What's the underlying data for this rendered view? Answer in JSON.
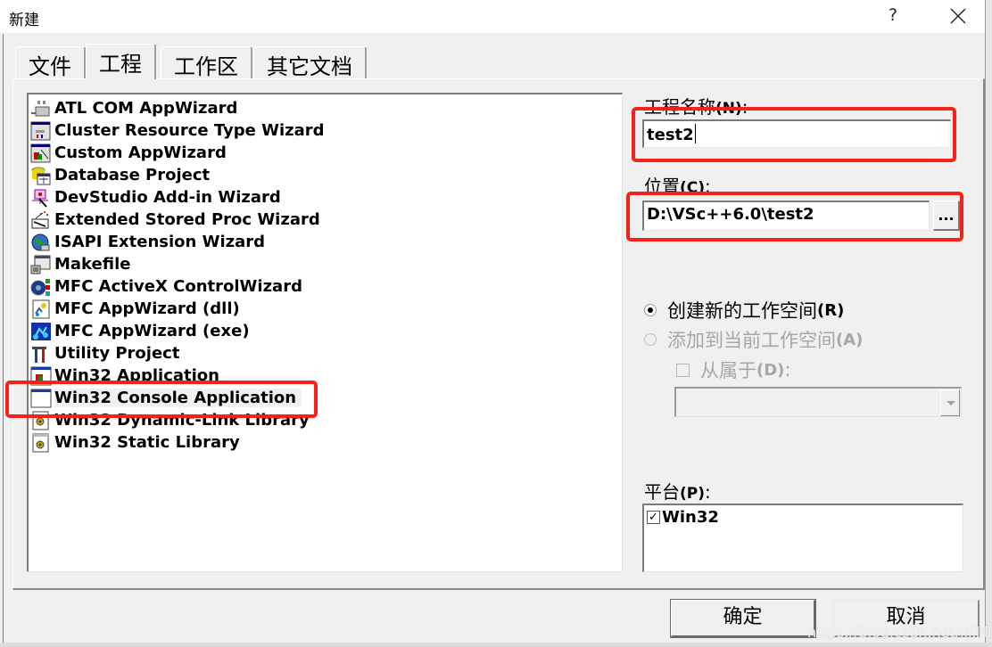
{
  "window": {
    "title": "新建",
    "help_label": "?",
    "close_icon": "close-icon"
  },
  "tabs": [
    {
      "label": "文件",
      "active": false
    },
    {
      "label": "工程",
      "active": true
    },
    {
      "label": "工作区",
      "active": false
    },
    {
      "label": "其它文档",
      "active": false
    }
  ],
  "project_types": [
    {
      "label": "ATL COM AppWizard",
      "icon": "atl-com-icon"
    },
    {
      "label": "Cluster Resource Type Wizard",
      "icon": "cluster-resource-icon"
    },
    {
      "label": "Custom AppWizard",
      "icon": "custom-appwizard-icon"
    },
    {
      "label": "Database Project",
      "icon": "database-icon"
    },
    {
      "label": "DevStudio Add-in Wizard",
      "icon": "devstudio-addin-icon"
    },
    {
      "label": "Extended Stored Proc Wizard",
      "icon": "stored-proc-icon"
    },
    {
      "label": "ISAPI Extension Wizard",
      "icon": "globe-icon"
    },
    {
      "label": "Makefile",
      "icon": "makefile-icon"
    },
    {
      "label": "MFC ActiveX ControlWizard",
      "icon": "activex-icon"
    },
    {
      "label": "MFC AppWizard (dll)",
      "icon": "mfc-dll-icon"
    },
    {
      "label": "MFC AppWizard (exe)",
      "icon": "mfc-exe-icon"
    },
    {
      "label": "Utility Project",
      "icon": "utility-icon"
    },
    {
      "label": "Win32 Application",
      "icon": "win32-app-icon"
    },
    {
      "label": "Win32 Console Application",
      "icon": "console-window-icon",
      "selected": true
    },
    {
      "label": "Win32 Dynamic-Link Library",
      "icon": "dll-icon"
    },
    {
      "label": "Win32 Static Library",
      "icon": "static-lib-icon"
    }
  ],
  "project_name": {
    "label": "工程名称",
    "accel": "(N)",
    "suffix": ":",
    "value": "test2"
  },
  "location": {
    "label": "位置",
    "accel": "(C)",
    "suffix": ":",
    "value": "D:\\VSc++6.0\\test2",
    "browse_label": "..."
  },
  "workspace": {
    "create_new": {
      "label": "创建新的工作空间",
      "accel": "(R)",
      "checked": true,
      "enabled": true
    },
    "add_to_current": {
      "label": "添加到当前工作空间",
      "accel": "(A)",
      "checked": false,
      "enabled": false
    },
    "dependency": {
      "label": "从属于",
      "accel": "(D)",
      "suffix": ":",
      "checked": false,
      "enabled": false
    },
    "dependency_value": ""
  },
  "platform": {
    "label": "平台",
    "accel": "(P)",
    "suffix": ":",
    "items": [
      {
        "label": "Win32",
        "checked": true
      }
    ]
  },
  "buttons": {
    "ok": "确定",
    "cancel": "取消"
  },
  "watermark": "https://blog.csdn.net/llllllllljg",
  "highlight_color": "#f5221b"
}
